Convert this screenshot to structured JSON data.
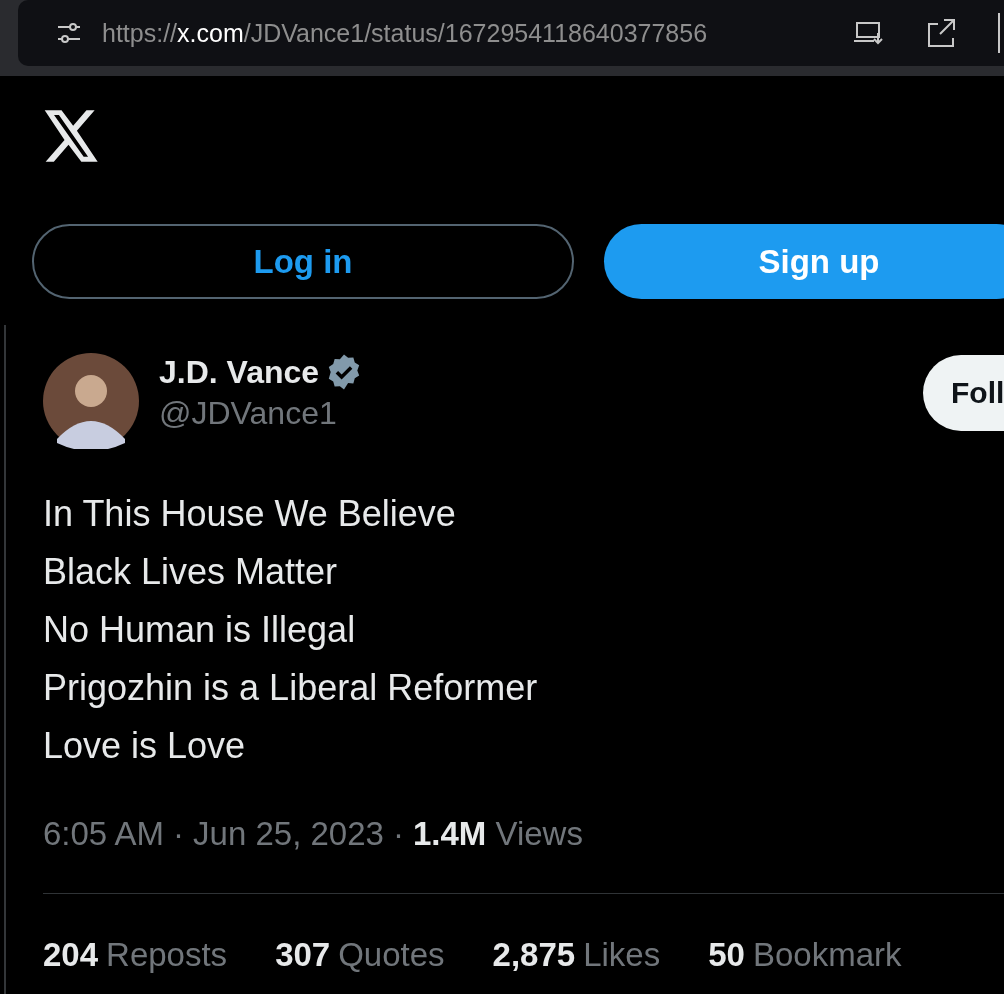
{
  "address_bar": {
    "scheme": "https://",
    "host": "x.com",
    "path": "/JDVance1/status/1672954118640377856"
  },
  "auth_buttons": [
    {
      "label": "Log in",
      "kind": "outline"
    },
    {
      "label": "Sign up",
      "kind": "filled"
    }
  ],
  "post": {
    "author": {
      "name": "J.D. Vance",
      "handle": "@JDVance1",
      "verified": true
    },
    "follow_button": "Foll",
    "lines": [
      "In This House We Believe",
      "Black Lives Matter",
      "No Human is Illegal",
      "Prigozhin is a Liberal Reformer",
      "Love is Love"
    ],
    "separator": "·",
    "time": "6:05 AM",
    "date": "Jun 25, 2023",
    "views_count": "1.4M",
    "views_label": "Views",
    "stats": [
      {
        "count": "204",
        "label": "Reposts"
      },
      {
        "count": "307",
        "label": "Quotes"
      },
      {
        "count": "2,875",
        "label": "Likes"
      },
      {
        "count": "50",
        "label": "Bookmark"
      }
    ]
  }
}
